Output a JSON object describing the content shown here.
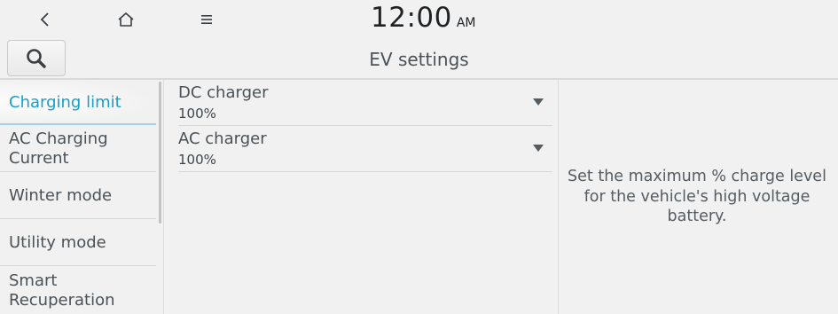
{
  "status_bar": {
    "time": "12:00",
    "ampm": "AM"
  },
  "icons": {
    "back": "back-arrow-icon",
    "home": "home-icon",
    "menu": "menu-icon",
    "search": "search-icon",
    "dropdown": "dropdown-arrow-icon"
  },
  "header": {
    "title": "EV settings"
  },
  "sidebar": {
    "items": [
      {
        "label": "Charging limit",
        "active": true
      },
      {
        "label": "AC Charging Current",
        "active": false
      },
      {
        "label": "Winter mode",
        "active": false
      },
      {
        "label": "Utility mode",
        "active": false
      },
      {
        "label": "Smart Recuperation",
        "active": false
      }
    ]
  },
  "main": {
    "settings": [
      {
        "name": "DC charger",
        "value": "100%"
      },
      {
        "name": "AC charger",
        "value": "100%"
      }
    ]
  },
  "help": {
    "text": "Set the maximum % charge level for the vehicle's high voltage battery."
  },
  "colors": {
    "background": "#f1f1f1",
    "accent": "#1a9dc9",
    "text": "#4a5257"
  }
}
